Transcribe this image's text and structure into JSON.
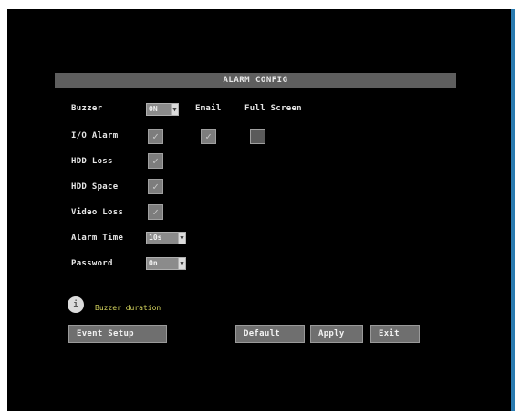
{
  "panel": {
    "title": "ALARM CONFIG"
  },
  "rows": {
    "buzzer": {
      "label": "Buzzer",
      "value": "ON",
      "email_label": "Email",
      "fullscreen_label": "Full Screen"
    },
    "io_alarm": {
      "label": "I/O Alarm",
      "checked": true,
      "email_checked": true,
      "fullscreen_checked": false
    },
    "hdd_loss": {
      "label": "HDD Loss",
      "checked": true
    },
    "hdd_space": {
      "label": "HDD Space",
      "checked": true
    },
    "video_loss": {
      "label": "Video Loss",
      "checked": true
    },
    "alarm_time": {
      "label": "Alarm Time",
      "value": "10s"
    },
    "password": {
      "label": "Password",
      "value": "On"
    }
  },
  "hint": {
    "icon": "info-icon",
    "text": "Buzzer duration"
  },
  "buttons": {
    "event_setup": "Event Setup",
    "default": "Default",
    "apply": "Apply",
    "exit": "Exit"
  },
  "colors": {
    "screen_bg": "#000000",
    "title_bar": "#5e5e5e",
    "hint_text": "#d8d860",
    "frame_edge": "#2a7bb0"
  }
}
